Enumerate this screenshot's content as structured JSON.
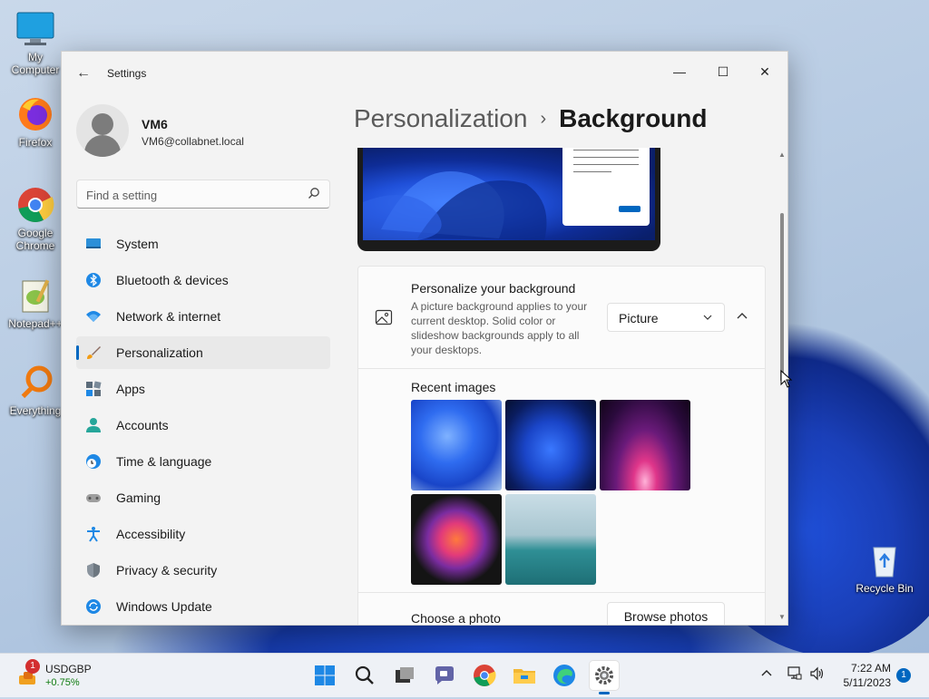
{
  "desktop": {
    "icons": [
      {
        "label": "My Computer"
      },
      {
        "label": "Firefox"
      },
      {
        "label": "Google Chrome"
      },
      {
        "label": "Notepad++"
      },
      {
        "label": "Everything"
      },
      {
        "label": "Recycle Bin"
      }
    ]
  },
  "window": {
    "title": "Settings",
    "controls": {
      "minimize": "—",
      "maximize": "☐",
      "close": "✕"
    }
  },
  "profile": {
    "name": "VM6",
    "email": "VM6@collabnet.local"
  },
  "search": {
    "placeholder": "Find a setting"
  },
  "sidebar": {
    "items": [
      {
        "label": "System",
        "icon": "system-icon"
      },
      {
        "label": "Bluetooth & devices",
        "icon": "bluetooth-icon"
      },
      {
        "label": "Network & internet",
        "icon": "wifi-icon"
      },
      {
        "label": "Personalization",
        "icon": "brush-icon",
        "active": true
      },
      {
        "label": "Apps",
        "icon": "apps-icon"
      },
      {
        "label": "Accounts",
        "icon": "person-icon"
      },
      {
        "label": "Time & language",
        "icon": "clock-globe-icon"
      },
      {
        "label": "Gaming",
        "icon": "gamepad-icon"
      },
      {
        "label": "Accessibility",
        "icon": "accessibility-icon"
      },
      {
        "label": "Privacy & security",
        "icon": "shield-icon"
      },
      {
        "label": "Windows Update",
        "icon": "update-icon"
      }
    ]
  },
  "breadcrumb": {
    "parent": "Personalization",
    "separator": "›",
    "current": "Background"
  },
  "background": {
    "title": "Personalize your background",
    "description": "A picture background applies to your current desktop. Solid color or slideshow backgrounds apply to all your desktops.",
    "selected": "Picture",
    "recent_title": "Recent images",
    "choose_photo": "Choose a photo",
    "browse_label": "Browse photos"
  },
  "taskbar": {
    "ticker": {
      "symbol": "USDGBP",
      "change": "+0.75%",
      "badge": "1"
    },
    "time": "7:22 AM",
    "date": "5/11/2023",
    "notifications": "1"
  },
  "colors": {
    "accent": "#0067c0"
  }
}
